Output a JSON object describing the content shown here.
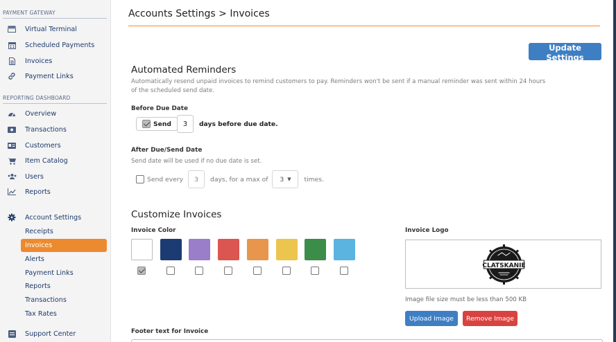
{
  "sidebar": {
    "payment_gateway": {
      "heading": "PAYMENT GATEWAY",
      "items": [
        {
          "label": "Virtual Terminal",
          "icon": "terminal-icon"
        },
        {
          "label": "Scheduled Payments",
          "icon": "calendar-icon"
        },
        {
          "label": "Invoices",
          "icon": "document-icon"
        },
        {
          "label": "Payment Links",
          "icon": "link-icon"
        }
      ]
    },
    "reporting": {
      "heading": "REPORTING DASHBOARD",
      "items": [
        {
          "label": "Overview",
          "icon": "gauge-icon"
        },
        {
          "label": "Transactions",
          "icon": "card-icon"
        },
        {
          "label": "Customers",
          "icon": "id-card-icon"
        },
        {
          "label": "Item Catalog",
          "icon": "cart-icon"
        },
        {
          "label": "Users",
          "icon": "users-icon"
        },
        {
          "label": "Reports",
          "icon": "chart-icon"
        }
      ]
    },
    "account_settings": {
      "label": "Account Settings",
      "icon": "gear-icon",
      "subitems": [
        {
          "label": "Receipts",
          "active": false
        },
        {
          "label": "Invoices",
          "active": true
        },
        {
          "label": "Alerts",
          "active": false
        },
        {
          "label": "Payment Links",
          "active": false
        },
        {
          "label": "Reports",
          "active": false
        },
        {
          "label": "Transactions",
          "active": false
        },
        {
          "label": "Tax Rates",
          "active": false
        }
      ]
    },
    "support": {
      "label": "Support Center",
      "icon": "support-icon"
    }
  },
  "header": {
    "title": "Accounts Settings > Invoices",
    "update_button": "Update Settings"
  },
  "reminders": {
    "heading": "Automated Reminders",
    "description": "Automatically resend unpaid invoices to remind customers to pay. Reminders won't be sent if a manual reminder was sent within 24 hours of the scheduled send date.",
    "before": {
      "label": "Before Due Date",
      "checked": true,
      "send_label": "Send",
      "days_value": "3",
      "suffix": "days before due date."
    },
    "after": {
      "label": "After Due/Send Date",
      "hint": "Send date will be used if no due date is set.",
      "checked": false,
      "send_label": "Send every",
      "days_value": "3",
      "middle": "days, for a max of",
      "max_value": "3",
      "suffix": "times."
    }
  },
  "customize": {
    "heading": "Customize Invoices",
    "color_label": "Invoice Color",
    "colors": [
      {
        "name": "white",
        "hex": "#ffffff",
        "selected": true
      },
      {
        "name": "navy",
        "hex": "#1c3b73",
        "selected": false
      },
      {
        "name": "purple",
        "hex": "#9b7ec9",
        "selected": false
      },
      {
        "name": "red",
        "hex": "#dc5651",
        "selected": false
      },
      {
        "name": "orange",
        "hex": "#e8954d",
        "selected": false
      },
      {
        "name": "yellow",
        "hex": "#ecc54f",
        "selected": false
      },
      {
        "name": "green",
        "hex": "#3c8c4a",
        "selected": false
      },
      {
        "name": "sky",
        "hex": "#5bb3e0",
        "selected": false
      }
    ],
    "logo_label": "Invoice Logo",
    "logo_text": "CLATSKANIE",
    "logo_hint": "Image file size must be less than 500 KB",
    "upload_button": "Upload Image",
    "remove_button": "Remove Image",
    "footer_label": "Footer text for Invoice",
    "footer_value": ""
  }
}
